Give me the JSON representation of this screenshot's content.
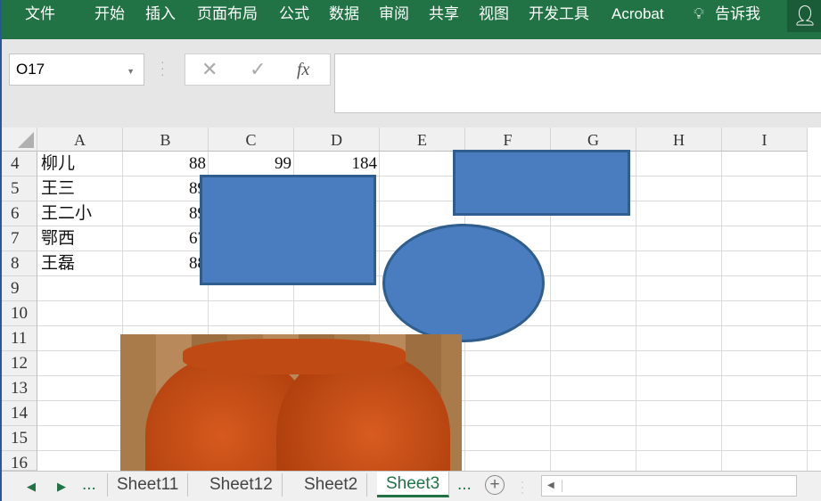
{
  "ribbon": {
    "tabs": [
      "文件",
      "开始",
      "插入",
      "页面布局",
      "公式",
      "数据",
      "审阅",
      "共享",
      "视图",
      "开发工具",
      "Acrobat"
    ],
    "tell_me": "告诉我"
  },
  "formula_bar": {
    "name_box": "O17",
    "cancel": "✕",
    "enter": "✓",
    "fx": "fx",
    "value": ""
  },
  "columns": [
    "A",
    "B",
    "C",
    "D",
    "E",
    "F",
    "G",
    "H",
    "I"
  ],
  "rows": [
    "4",
    "5",
    "6",
    "7",
    "8",
    "9",
    "10",
    "11",
    "12",
    "13",
    "14",
    "15",
    "16"
  ],
  "cells": [
    {
      "row": "4",
      "A": "柳儿",
      "B": "88",
      "C": "99",
      "D": "184"
    },
    {
      "row": "5",
      "A": "王三",
      "B": "89"
    },
    {
      "row": "6",
      "A": "王二小",
      "B": "89"
    },
    {
      "row": "7",
      "A": "鄂西",
      "B": "67"
    },
    {
      "row": "8",
      "A": "王磊",
      "B": "88"
    }
  ],
  "sheets": {
    "tabs": [
      "Sheet11",
      "Sheet12",
      "Sheet2",
      "Sheet3"
    ],
    "active": "Sheet3",
    "more": "...",
    "add": "+"
  },
  "colors": {
    "ribbon": "#217346",
    "shape_fill": "#4a7cc0",
    "shape_border": "#2f5d8e"
  }
}
